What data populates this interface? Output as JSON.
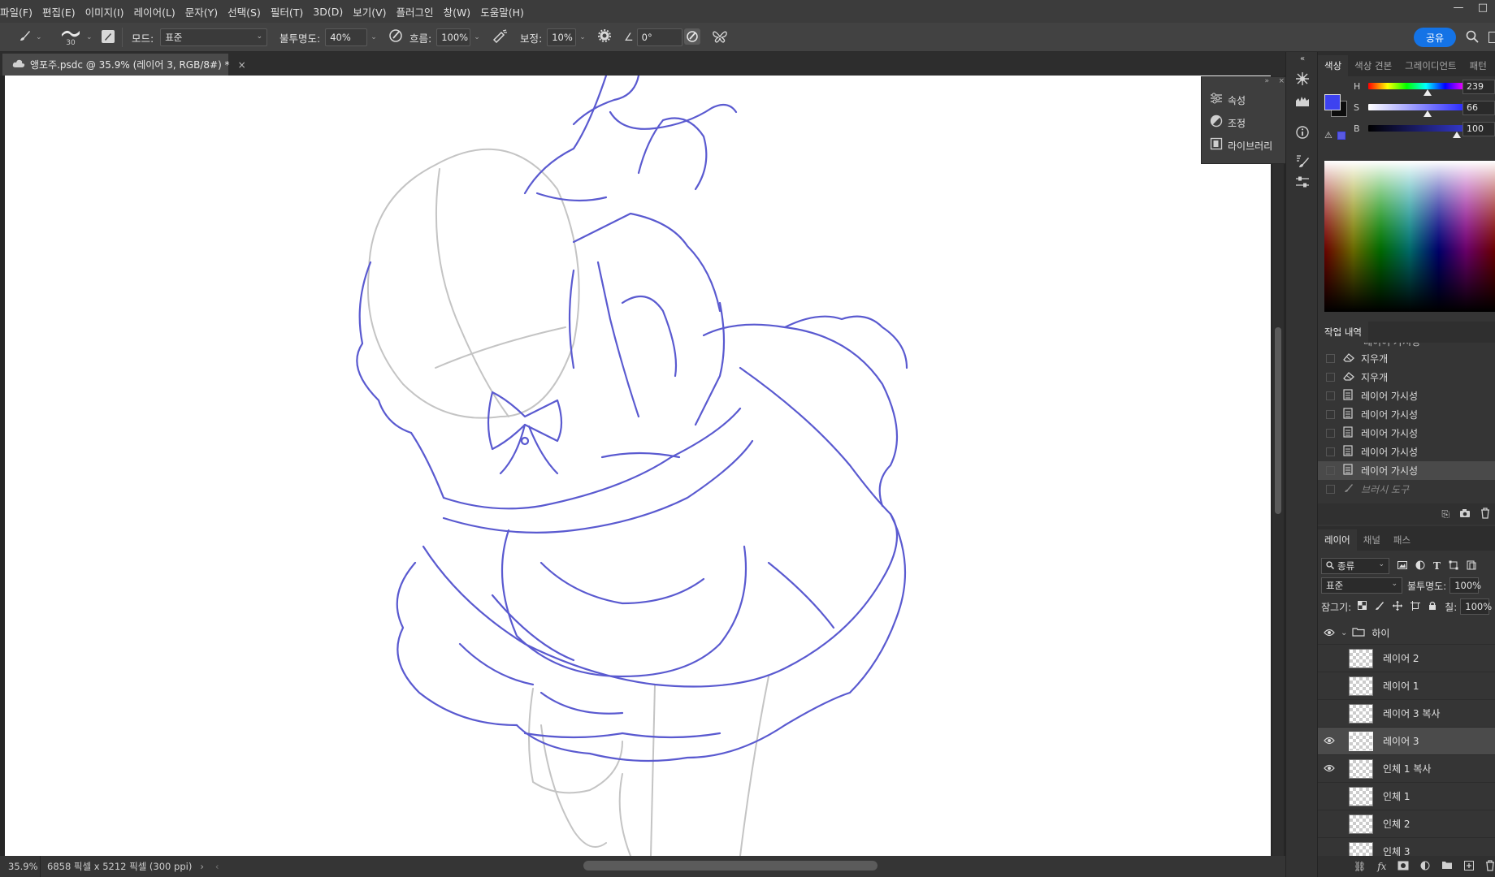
{
  "menu": [
    "파일(F)",
    "편집(E)",
    "이미지(I)",
    "레이어(L)",
    "문자(Y)",
    "선택(S)",
    "필터(T)",
    "3D(D)",
    "보기(V)",
    "플러그인",
    "창(W)",
    "도움말(H)"
  ],
  "window_controls": [
    "—",
    "□"
  ],
  "options": {
    "brush_size": "30",
    "mode_label": "모드:",
    "mode_value": "표준",
    "opacity_label": "불투명도:",
    "opacity_value": "40%",
    "flow_label": "흐름:",
    "flow_value": "100%",
    "smoothing_label": "보정:",
    "smoothing_value": "10%",
    "angle_value": "0°",
    "share_label": "공유"
  },
  "document": {
    "tab_title": "앵포주.psdc @ 35.9% (레이어 3, RGB/8#) *",
    "zoom": "35.9%",
    "dimensions": "6858 픽셀 x 5212 픽셀 (300 ppi)"
  },
  "float_panel": {
    "items": [
      "속성",
      "조정",
      "라이브러리"
    ]
  },
  "color_panel": {
    "tabs": [
      "색상",
      "색상 견본",
      "그레이디언트",
      "패턴"
    ],
    "fg_color": "#3d42f0",
    "bg_color": "#0d0d0d",
    "h_label": "H",
    "h_value": "239",
    "s_label": "S",
    "s_value": "66",
    "b_label": "B",
    "b_value": "100"
  },
  "history_panel": {
    "title": "작업 내역",
    "items": [
      {
        "label": "지우개",
        "icon": "eraser-icon"
      },
      {
        "label": "지우개",
        "icon": "eraser-icon"
      },
      {
        "label": "레이어 가시성",
        "icon": "document-icon"
      },
      {
        "label": "레이어 가시성",
        "icon": "document-icon"
      },
      {
        "label": "레이어 가시성",
        "icon": "document-icon"
      },
      {
        "label": "레이어 가시성",
        "icon": "document-icon"
      },
      {
        "label": "레이어 가시성",
        "icon": "document-icon"
      },
      {
        "label": "브러시 도구",
        "icon": "brush-icon"
      }
    ]
  },
  "layers_panel": {
    "tabs": [
      "레이어",
      "채널",
      "패스"
    ],
    "filter_value": "종류",
    "blend_mode": "표준",
    "opacity_label": "불투명도:",
    "opacity_value": "100%",
    "lock_label": "잠그기:",
    "fill_label": "칠:",
    "fill_value": "100%",
    "group_name": "하이",
    "layers": [
      {
        "name": "레이어 2",
        "visible": false,
        "selected": false
      },
      {
        "name": "레이어 1",
        "visible": false,
        "selected": false
      },
      {
        "name": "레이어 3 복사",
        "visible": false,
        "selected": false
      },
      {
        "name": "레이어 3",
        "visible": true,
        "selected": true
      },
      {
        "name": "인체 1 복사",
        "visible": true,
        "selected": false
      },
      {
        "name": "인체 1",
        "visible": false,
        "selected": false
      },
      {
        "name": "인체 2",
        "visible": false,
        "selected": false
      },
      {
        "name": "인체 3",
        "visible": false,
        "selected": false
      }
    ]
  }
}
